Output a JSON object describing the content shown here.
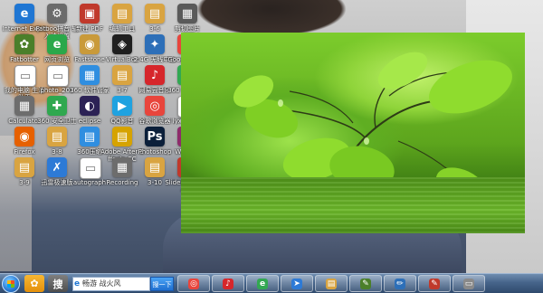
{
  "desktop": {
    "icons": [
      {
        "label": "Internet Explorer",
        "icon": "ie-icon",
        "color": "#1f76d3",
        "glyph": "e"
      },
      {
        "label": "Fatboo拼音 输入法设置",
        "icon": "settings-icon",
        "color": "#6b6b6b",
        "glyph": "⚙"
      },
      {
        "label": "新建 PDF",
        "icon": "pdf-icon",
        "color": "#c0392b",
        "glyph": "▣"
      },
      {
        "label": "编辑工具",
        "icon": "folder-icon",
        "color": "#d9a441",
        "glyph": "▤"
      },
      {
        "label": "3-6",
        "icon": "folder-icon",
        "color": "#d9a441",
        "glyph": "▤"
      },
      {
        "label": "剪切图片",
        "icon": "image-icon",
        "color": "#5a5a5a",
        "glyph": "▦"
      },
      {
        "label": "Fatbotter",
        "icon": "app-icon",
        "color": "#4b7f2a",
        "glyph": "✿"
      },
      {
        "label": "网页浏览",
        "icon": "browser-icon",
        "color": "#2aa84a",
        "glyph": "e"
      },
      {
        "label": "Faststone",
        "icon": "faststone-icon",
        "color": "#c99a3a",
        "glyph": "◉"
      },
      {
        "label": "VirtualBox",
        "icon": "vbox-icon",
        "color": "#1f1f1f",
        "glyph": "◈"
      },
      {
        "label": "2.4G 无线中心",
        "icon": "wifi-icon",
        "color": "#2d6fb8",
        "glyph": "✦"
      },
      {
        "label": "Google Chrome",
        "icon": "chrome-icon",
        "color": "#e8453c",
        "glyph": "◎"
      },
      {
        "label": "我的电脑 生活助手",
        "icon": "doc-icon",
        "color": "#ffffff",
        "glyph": "▭"
      },
      {
        "label": "photo_201",
        "icon": "doc-icon",
        "color": "#ffffff",
        "glyph": "▭"
      },
      {
        "label": "360 软件管家",
        "icon": "app-icon",
        "color": "#2f8ee0",
        "glyph": "▦"
      },
      {
        "label": "3-7",
        "icon": "folder-icon",
        "color": "#d9a441",
        "glyph": "▤"
      },
      {
        "label": "网易云音乐",
        "icon": "music-icon",
        "color": "#d6262b",
        "glyph": "♪"
      },
      {
        "label": "360 安全浏览器",
        "icon": "browser-icon",
        "color": "#32a852",
        "glyph": "e"
      },
      {
        "label": "Calculator",
        "icon": "calc-icon",
        "color": "#6d6d6d",
        "glyph": "▦"
      },
      {
        "label": "360 安全卫士",
        "icon": "shield-icon",
        "color": "#2fa84f",
        "glyph": "✚"
      },
      {
        "label": "eclipse",
        "icon": "eclipse-icon",
        "color": "#2c2255",
        "glyph": "◐"
      },
      {
        "label": "QQ影音",
        "icon": "video-icon",
        "color": "#1fa2e0",
        "glyph": "▶"
      },
      {
        "label": "谷歌浏览器",
        "icon": "browser-icon",
        "color": "#e8453c",
        "glyph": "◎"
      },
      {
        "label": "lyx-demo",
        "icon": "doc-icon",
        "color": "#ffffff",
        "glyph": "▭"
      },
      {
        "label": "Firefox",
        "icon": "firefox-icon",
        "color": "#e66000",
        "glyph": "◉"
      },
      {
        "label": "3-8",
        "icon": "folder-icon",
        "color": "#d9a441",
        "glyph": "▤"
      },
      {
        "label": "360压缩",
        "icon": "zip-icon",
        "color": "#2f8ee0",
        "glyph": "▤"
      },
      {
        "label": "Adobe After Effects CC",
        "icon": "ae-icon",
        "color": "#d6a300",
        "glyph": "▤"
      },
      {
        "label": "Photoshop",
        "icon": "ps-icon",
        "color": "#0b1f3a",
        "glyph": "Ps"
      },
      {
        "label": "WinRAR",
        "icon": "winrar-icon",
        "color": "#8e2b6b",
        "glyph": "▤"
      },
      {
        "label": "3-9",
        "icon": "folder-icon",
        "color": "#d9a441",
        "glyph": "▤"
      },
      {
        "label": "迅雷极速版",
        "icon": "thunder-icon",
        "color": "#2d7ad6",
        "glyph": "✗"
      },
      {
        "label": "autograph",
        "icon": "doc-icon",
        "color": "#ffffff",
        "glyph": "▭"
      },
      {
        "label": "Recording",
        "icon": "calc-icon",
        "color": "#6d6d6d",
        "glyph": "▦"
      },
      {
        "label": "3-10",
        "icon": "folder-icon",
        "color": "#d9a441",
        "glyph": "▤"
      },
      {
        "label": "Slideshow Creator",
        "icon": "slideshow-icon",
        "color": "#c0392b",
        "glyph": "◆"
      }
    ]
  },
  "taskbar": {
    "search_value": "畅游 战火风",
    "search_button": "搜一下",
    "pinned": [
      {
        "name": "taskbar-app-360",
        "color": "#f2a21b",
        "glyph": "✿"
      },
      {
        "name": "taskbar-app-sogou",
        "color": "#5a5a5a",
        "glyph": "搜"
      },
      {
        "name": "taskbar-app-chrome",
        "color": "#e8453c",
        "glyph": "◎"
      },
      {
        "name": "taskbar-app-music",
        "color": "#d6262b",
        "glyph": "♪"
      },
      {
        "name": "taskbar-app-360browser",
        "color": "#32a852",
        "glyph": "e"
      },
      {
        "name": "taskbar-app-send",
        "color": "#2d7ad6",
        "glyph": "➤"
      },
      {
        "name": "taskbar-app-explorer",
        "color": "#d9a441",
        "glyph": "▤"
      },
      {
        "name": "taskbar-app-tool",
        "color": "#4b7f2a",
        "glyph": "✎"
      },
      {
        "name": "taskbar-app-pen",
        "color": "#2d6fb8",
        "glyph": "✏"
      },
      {
        "name": "taskbar-app-paint",
        "color": "#c0392b",
        "glyph": "✎"
      },
      {
        "name": "taskbar-app-media",
        "color": "#8a8a8a",
        "glyph": "▭"
      }
    ]
  }
}
